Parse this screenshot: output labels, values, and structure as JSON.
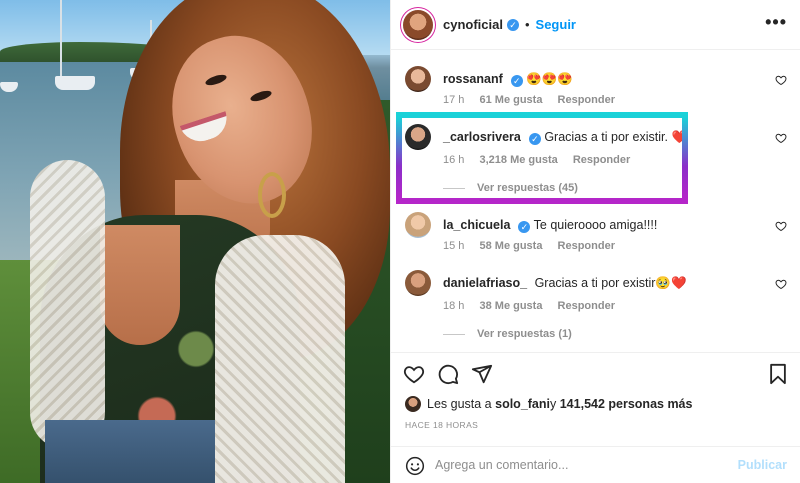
{
  "post": {
    "author": "cynoficial",
    "follow_label": "Seguir",
    "more_label": "•••",
    "separator": "•"
  },
  "comments": [
    {
      "username": "rossananf",
      "text": "😍😍😍",
      "time": "17 h",
      "likes": "61 Me gusta",
      "reply": "Responder",
      "verified": true
    },
    {
      "username": "_carlosrivera",
      "text": "Gracias a ti por existir. ❤️",
      "time": "16 h",
      "likes": "3,218 Me gusta",
      "reply": "Responder",
      "verified": true,
      "view_replies": "Ver respuestas (45)"
    },
    {
      "username": "la_chicuela",
      "text": "Te quieroooo amiga!!!!",
      "time": "15 h",
      "likes": "58 Me gusta",
      "reply": "Responder",
      "verified": true
    },
    {
      "username": "danielafriaso_",
      "text": "Gracias a ti por existir🥹❤️",
      "time": "18 h",
      "likes": "38 Me gusta",
      "reply": "Responder",
      "verified": false,
      "view_replies": "Ver respuestas (1)"
    }
  ],
  "verified_mark": "✓",
  "likes_summary": {
    "prefix": "Les gusta a ",
    "user": "solo_fani",
    "middle": " y ",
    "count": "141,542 personas más"
  },
  "timestamp": "HACE 18 HORAS",
  "comment_box": {
    "placeholder": "Agrega un comentario...",
    "publish_label": "Publicar"
  },
  "icons": {
    "like": "heart-icon",
    "comment": "comment-icon",
    "share": "share-icon",
    "save": "bookmark-icon",
    "emoji": "emoji-icon",
    "more": "more-options-icon"
  }
}
